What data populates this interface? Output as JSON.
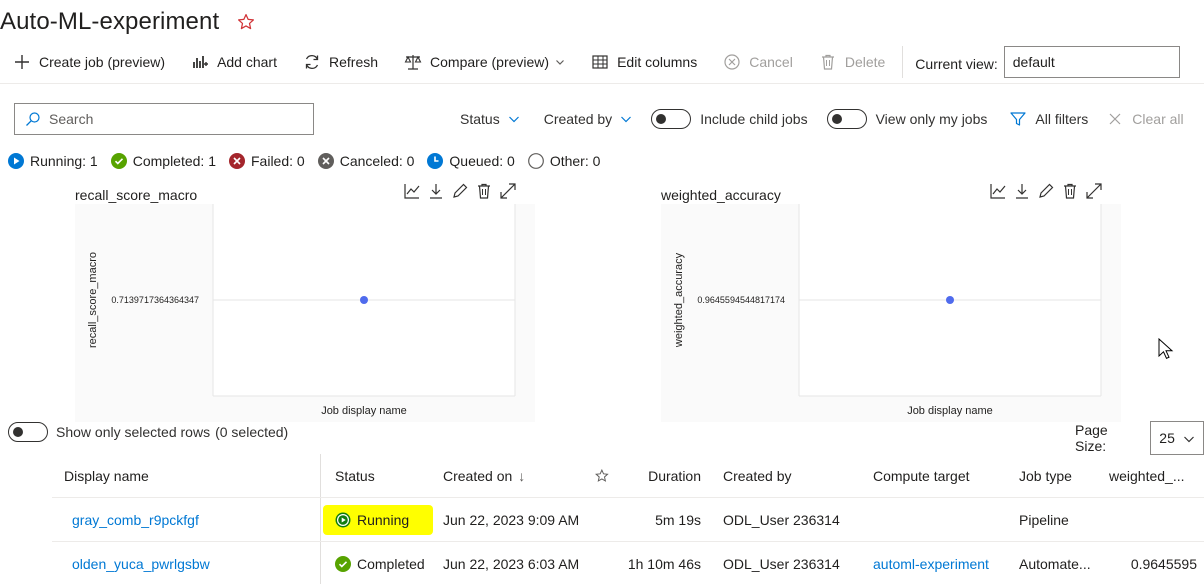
{
  "page": {
    "title": "Auto-ML-experiment"
  },
  "toolbar": {
    "create_job": "Create job (preview)",
    "add_chart": "Add chart",
    "refresh": "Refresh",
    "compare": "Compare (preview)",
    "edit_columns": "Edit columns",
    "cancel": "Cancel",
    "delete": "Delete",
    "current_view_label": "Current view:",
    "current_view_value": "default"
  },
  "search": {
    "placeholder": "Search"
  },
  "filters": {
    "status": "Status",
    "created_by": "Created by",
    "include_child_jobs": "Include child jobs",
    "view_only_my_jobs": "View only my jobs",
    "all_filters": "All filters",
    "clear_all": "Clear all"
  },
  "status_summary": {
    "running": "Running: 1",
    "completed": "Completed: 1",
    "failed": "Failed: 0",
    "canceled": "Canceled: 0",
    "queued": "Queued: 0",
    "other": "Other: 0"
  },
  "colors": {
    "running": "#0078d4",
    "completed": "#57a300",
    "failed": "#a4262c",
    "canceled": "#605e5c",
    "point": "#4f6bed",
    "link": "#0078d4",
    "highlight": "#ffff00"
  },
  "charts": {
    "left": {
      "title": "recall_score_macro"
    },
    "right": {
      "title": "weighted_accuracy"
    }
  },
  "chart_data": [
    {
      "type": "scatter",
      "title": "recall_score_macro",
      "xlabel": "Job display name",
      "ylabel": "recall_score_macro",
      "y_tick_labels": [
        "0.7139717364364347"
      ],
      "points": [
        {
          "x": "",
          "y": 0.7139717364364347
        }
      ],
      "grid": true
    },
    {
      "type": "scatter",
      "title": "weighted_accuracy",
      "xlabel": "Job display name",
      "ylabel": "weighted_accuracy",
      "y_tick_labels": [
        "0.9645594544817174"
      ],
      "points": [
        {
          "x": "",
          "y": 0.9645594544817174
        }
      ],
      "grid": true
    }
  ],
  "selection": {
    "label": "Show only selected rows",
    "count": "(0 selected)"
  },
  "pagination": {
    "label": "Page Size:",
    "value": "25"
  },
  "table": {
    "headers": {
      "display_name": "Display name",
      "status": "Status",
      "created_on": "Created on",
      "sort_indicator": "↓",
      "duration": "Duration",
      "created_by": "Created by",
      "compute_target": "Compute target",
      "job_type": "Job type",
      "weighted": "weighted_..."
    },
    "rows": [
      {
        "display_name": "gray_comb_r9pckfgf",
        "status": "Running",
        "created_on": "Jun 22, 2023 9:09 AM",
        "duration": "5m 19s",
        "created_by": "ODL_User 236314",
        "compute_target": "",
        "job_type": "Pipeline",
        "weighted": ""
      },
      {
        "display_name": "olden_yuca_pwrlgsbw",
        "status": "Completed",
        "created_on": "Jun 22, 2023 6:03 AM",
        "duration": "1h 10m 46s",
        "created_by": "ODL_User 236314",
        "compute_target": "automl-experiment",
        "job_type": "Automate...",
        "weighted": "0.9645595"
      }
    ]
  }
}
